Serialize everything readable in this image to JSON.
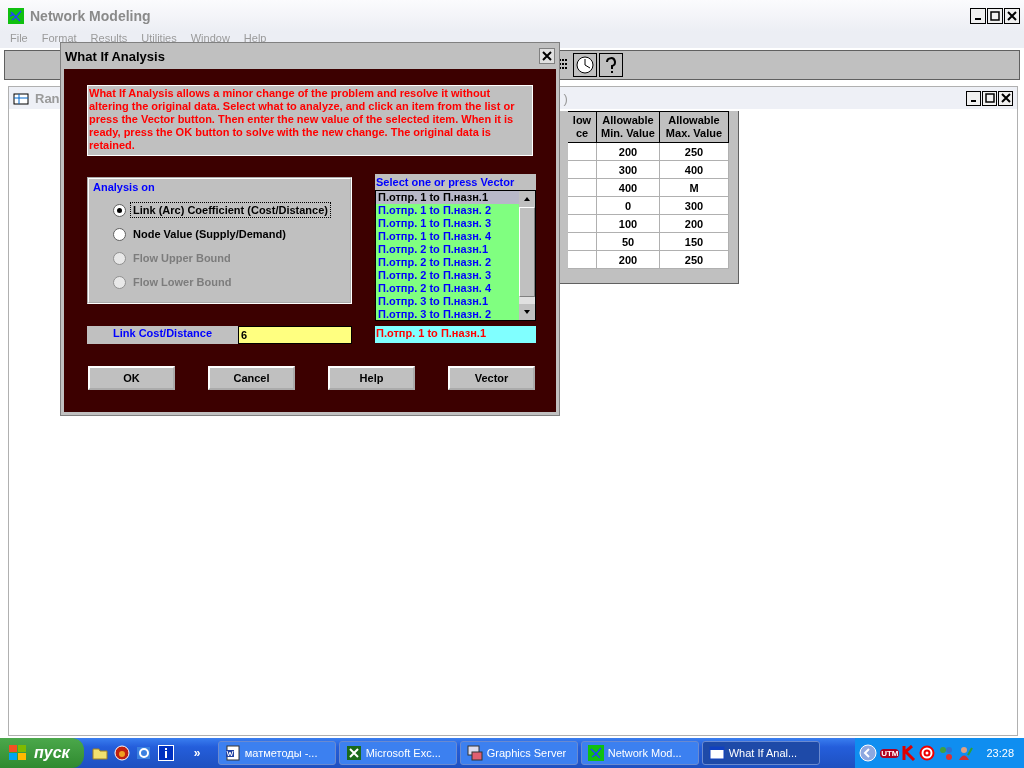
{
  "window": {
    "title": "Network Modeling",
    "menu": [
      "File",
      "Format",
      "Results",
      "Utilities",
      "Window",
      "Help"
    ]
  },
  "child_window": {
    "title_start": "Ran",
    "title_end": ")",
    "table": {
      "columns": [
        "low ce",
        "Allowable Min. Value",
        "Allowable Max. Value"
      ],
      "rows": [
        [
          "",
          "200",
          "250"
        ],
        [
          "",
          "300",
          "400"
        ],
        [
          "",
          "400",
          "M"
        ],
        [
          "",
          "0",
          "300"
        ],
        [
          "",
          "100",
          "200"
        ],
        [
          "",
          "50",
          "150"
        ],
        [
          "",
          "200",
          "250"
        ]
      ]
    }
  },
  "dialog": {
    "title": "What If Analysis",
    "description": "What If Analysis allows a minor change of the problem and resolve it without altering the original data.  Select what to analyze, and click an item from the list or press the Vector button.  Then enter the new value of the selected item.  When it is ready, press the OK button to solve with the new change.  The original data is retained.",
    "group": {
      "title": "Analysis on",
      "options": [
        {
          "label": "Link (Arc) Coefficient (Cost/Distance)",
          "selected": true,
          "disabled": false
        },
        {
          "label": "Node Value (Supply/Demand)",
          "selected": false,
          "disabled": false
        },
        {
          "label": "Flow Upper Bound",
          "selected": false,
          "disabled": true
        },
        {
          "label": "Flow Lower Bound",
          "selected": false,
          "disabled": true
        }
      ]
    },
    "list": {
      "header": "Select one or press Vector",
      "items": [
        {
          "label": "П.отпр. 1 to П.назн.1",
          "selected": true
        },
        {
          "label": "П.отпр. 1 to П.назн. 2",
          "selected": false
        },
        {
          "label": "П.отпр. 1 to П.назн. 3",
          "selected": false
        },
        {
          "label": "П.отпр. 1 to П.назн. 4",
          "selected": false
        },
        {
          "label": "П.отпр. 2 to П.назн.1",
          "selected": false
        },
        {
          "label": "П.отпр. 2 to П.назн. 2",
          "selected": false
        },
        {
          "label": "П.отпр. 2 to П.назн. 3",
          "selected": false
        },
        {
          "label": "П.отпр. 2 to П.назн. 4",
          "selected": false
        },
        {
          "label": "П.отпр. 3 to П.назн.1",
          "selected": false
        },
        {
          "label": "П.отпр. 3 to П.назн. 2",
          "selected": false
        }
      ]
    },
    "value_field": {
      "label": "Link Cost/Distance",
      "value": "6"
    },
    "selection": "П.отпр. 1 to П.назн.1",
    "buttons": [
      "OK",
      "Cancel",
      "Help",
      "Vector"
    ]
  },
  "taskbar": {
    "start": "пуск",
    "more": "»",
    "tasks": [
      {
        "label": "матметоды -...",
        "kind": "word",
        "selected": false
      },
      {
        "label": "Microsoft Exc...",
        "kind": "excel",
        "selected": false
      },
      {
        "label": "Graphics Server",
        "kind": "graphics",
        "selected": false
      },
      {
        "label": "Network Mod...",
        "kind": "network",
        "selected": false
      },
      {
        "label": "What If Anal...",
        "kind": "window",
        "selected": true
      }
    ],
    "tray_label": "UTM",
    "clock": "23:28"
  }
}
